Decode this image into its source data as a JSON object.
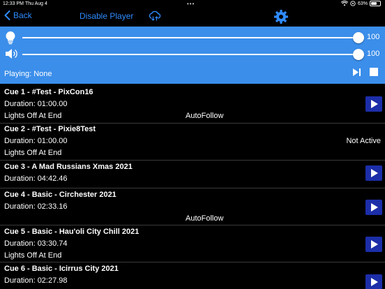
{
  "status": {
    "time": "12:33 PM",
    "date": "Thu Aug 4",
    "battery_text": "63%",
    "battery_level": 0.63
  },
  "nav": {
    "back_label": "Back",
    "disable_label": "Disable Player",
    "cloud_icon": "cloud-sync-icon",
    "gear_icon": "gear-icon",
    "accent": "#2f8bff"
  },
  "controls": {
    "background": "#3b8eea",
    "brightness_value": "100",
    "brightness_level": 100,
    "volume_value": "100",
    "volume_level": 100,
    "playing_text": "Playing: None"
  },
  "cues": [
    {
      "title": "Cue 1 - #Test - PixCon16",
      "duration": "Duration: 01:00.00",
      "lights": "Lights Off At End",
      "autofollow": "AutoFollow",
      "status": "",
      "playable": true
    },
    {
      "title": "Cue 2 - #Test - Pixie8Test",
      "duration": "Duration: 01:00.00",
      "lights": "Lights Off At End",
      "autofollow": "",
      "status": "Not Active",
      "playable": false
    },
    {
      "title": "Cue 3 - A Mad Russians Xmas 2021",
      "duration": "Duration: 04:42.46",
      "lights": "",
      "autofollow": "",
      "status": "",
      "playable": true
    },
    {
      "title": "Cue 4 - Basic - Circhester 2021",
      "duration": "Duration: 02:33.16",
      "lights": "",
      "autofollow": "AutoFollow",
      "status": "",
      "playable": true
    },
    {
      "title": "Cue 5 - Basic - Hau'oli City Chill 2021",
      "duration": "Duration: 03:30.74",
      "lights": "Lights Off At End",
      "autofollow": "",
      "status": "",
      "playable": true
    },
    {
      "title": "Cue 6 - Basic - Icirrus City 2021",
      "duration": "Duration: 02:27.98",
      "lights": "",
      "autofollow": "",
      "status": "",
      "playable": true
    }
  ]
}
